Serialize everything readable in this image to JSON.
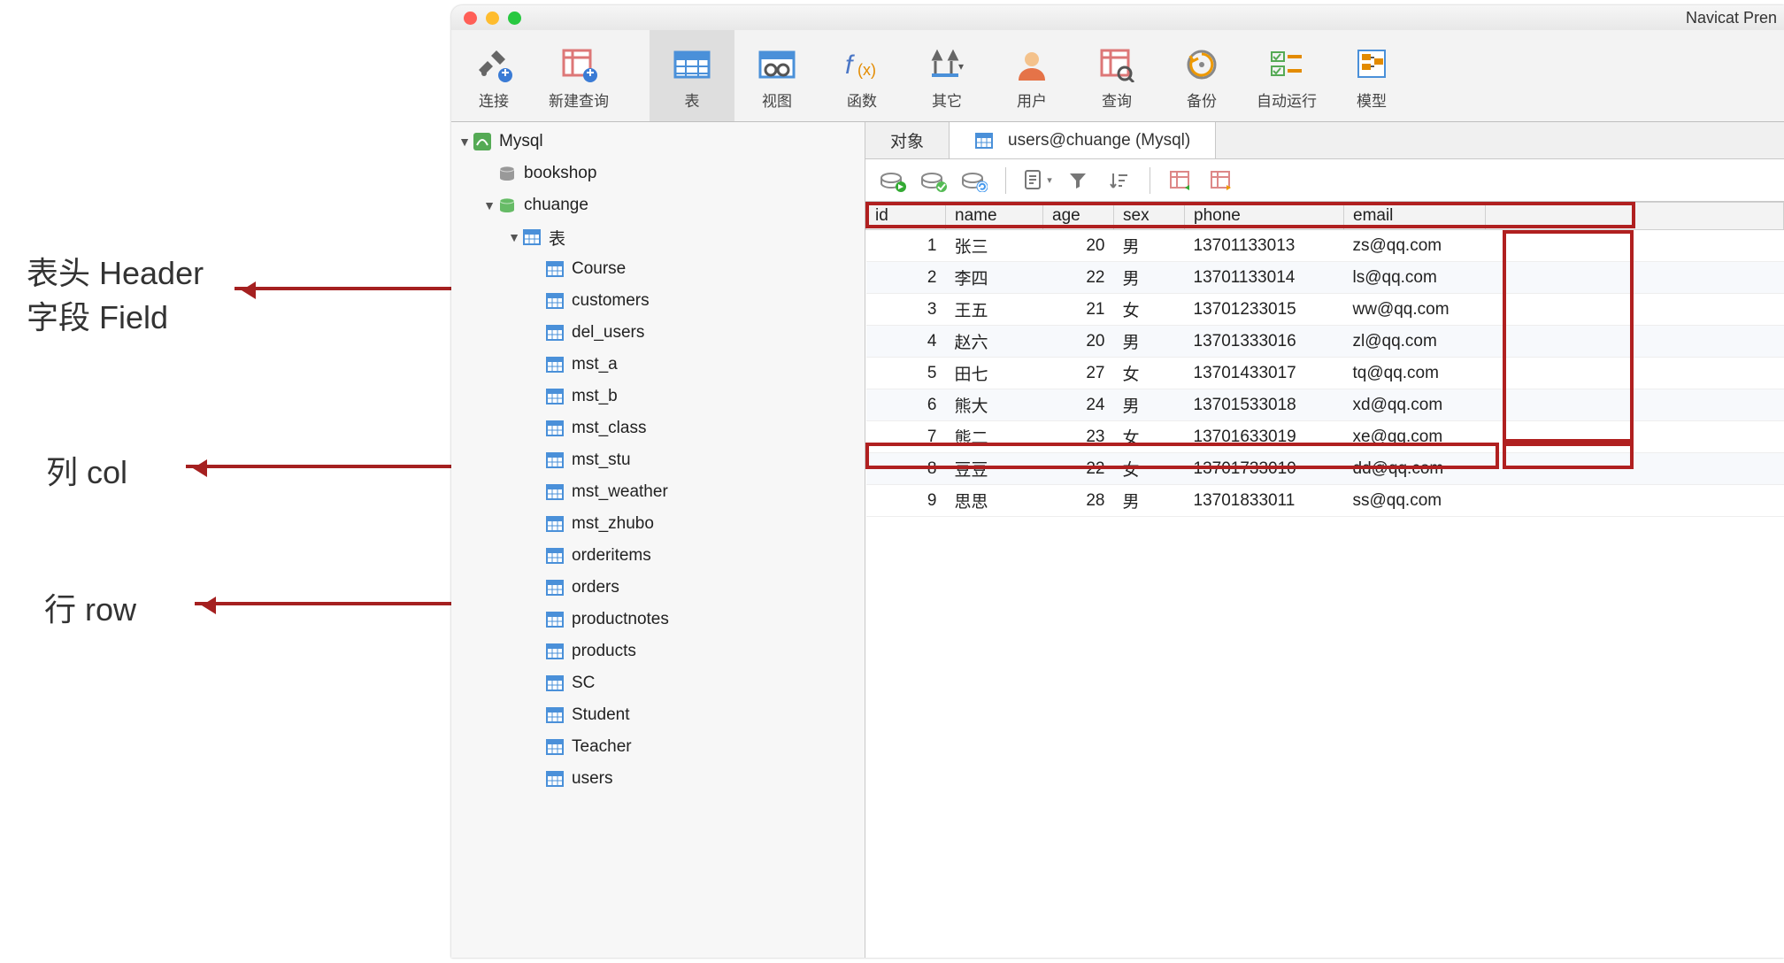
{
  "app_title": "Navicat Pren",
  "annotations": {
    "header": "表头 Header",
    "field": "字段 Field",
    "col": "列 col",
    "row": "行 row"
  },
  "toolbar": [
    {
      "id": "connect",
      "label": "连接"
    },
    {
      "id": "newquery",
      "label": "新建查询"
    },
    {
      "id": "table",
      "label": "表",
      "active": true
    },
    {
      "id": "view",
      "label": "视图"
    },
    {
      "id": "function",
      "label": "函数"
    },
    {
      "id": "other",
      "label": "其它"
    },
    {
      "id": "user",
      "label": "用户"
    },
    {
      "id": "query",
      "label": "查询"
    },
    {
      "id": "backup",
      "label": "备份"
    },
    {
      "id": "autorun",
      "label": "自动运行"
    },
    {
      "id": "model",
      "label": "模型"
    }
  ],
  "tree": {
    "root": "Mysql",
    "databases": [
      {
        "name": "bookshop",
        "open": false
      },
      {
        "name": "chuange",
        "open": true,
        "groups": [
          {
            "name": "表",
            "items": [
              "Course",
              "customers",
              "del_users",
              "mst_a",
              "mst_b",
              "mst_class",
              "mst_stu",
              "mst_weather",
              "mst_zhubo",
              "orderitems",
              "orders",
              "productnotes",
              "products",
              "SC",
              "Student",
              "Teacher",
              "users"
            ]
          }
        ]
      }
    ]
  },
  "tabs": [
    {
      "id": "objects",
      "label": "对象"
    },
    {
      "id": "users-table",
      "label": "users@chuange (Mysql)",
      "active": true
    }
  ],
  "columns": [
    "id",
    "name",
    "age",
    "sex",
    "phone",
    "email"
  ],
  "rows": [
    {
      "id": 1,
      "name": "张三",
      "age": 20,
      "sex": "男",
      "phone": "13701133013",
      "email": "zs@qq.com"
    },
    {
      "id": 2,
      "name": "李四",
      "age": 22,
      "sex": "男",
      "phone": "13701133014",
      "email": "ls@qq.com"
    },
    {
      "id": 3,
      "name": "王五",
      "age": 21,
      "sex": "女",
      "phone": "13701233015",
      "email": "ww@qq.com"
    },
    {
      "id": 4,
      "name": "赵六",
      "age": 20,
      "sex": "男",
      "phone": "13701333016",
      "email": "zl@qq.com"
    },
    {
      "id": 5,
      "name": "田七",
      "age": 27,
      "sex": "女",
      "phone": "13701433017",
      "email": "tq@qq.com"
    },
    {
      "id": 6,
      "name": "熊大",
      "age": 24,
      "sex": "男",
      "phone": "13701533018",
      "email": "xd@qq.com"
    },
    {
      "id": 7,
      "name": "熊二",
      "age": 23,
      "sex": "女",
      "phone": "13701633019",
      "email": "xe@qq.com"
    },
    {
      "id": 8,
      "name": "豆豆",
      "age": 22,
      "sex": "女",
      "phone": "13701733010",
      "email": "dd@qq.com"
    },
    {
      "id": 9,
      "name": "思思",
      "age": 28,
      "sex": "男",
      "phone": "13701833011",
      "email": "ss@qq.com"
    }
  ],
  "cursor_row": 6
}
